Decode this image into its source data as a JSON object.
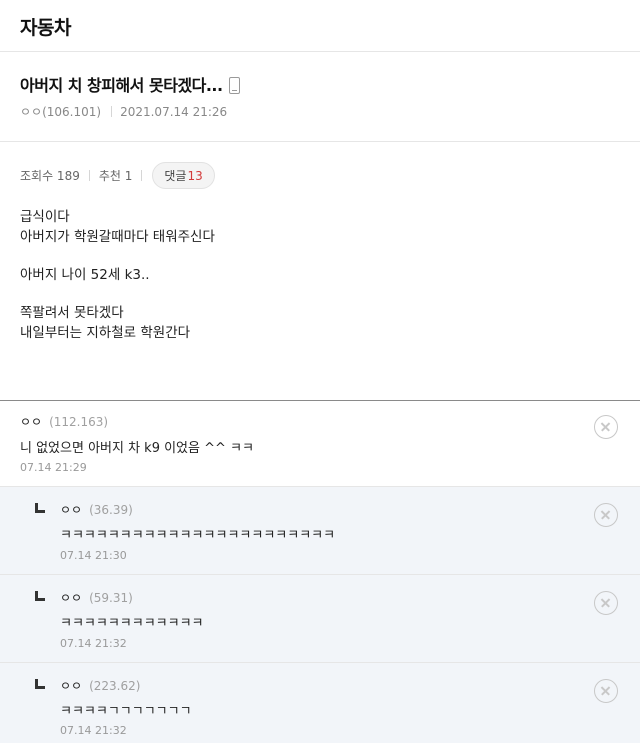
{
  "board": {
    "title": "자동차"
  },
  "post": {
    "title": "아버지 치 창피해서 못타겠다...",
    "author": "ㅇㅇ(106.101)",
    "datetime": "2021.07.14 21:26",
    "views_label": "조회수 189",
    "recommend_label": "추천 1",
    "comment_label": "댓글",
    "comment_count": "13",
    "body_lines": [
      "급식이다",
      "아버지가 학원갈때마다 태워주신다",
      "",
      "아버지 나이 52세 k3..",
      "",
      "쪽팔려서 못타겠다",
      "내일부터는 지하철로 학원간다"
    ]
  },
  "comments": [
    {
      "author": "ㅇㅇ",
      "ip": "(112.163)",
      "text": "니 없었으면 아버지 차 k9 이었음 ^^ ㅋㅋ",
      "date": "07.14 21:29"
    },
    {
      "author": "ㅇㅇ",
      "ip": "(36.39)",
      "text": "ㅋㅋㅋㅋㅋㅋㅋㅋㅋㅋㅋㅋㅋㅋㅋㅋㅋㅋㅋㅋㅋㅋㅋ",
      "date": "07.14 21:30"
    },
    {
      "author": "ㅇㅇ",
      "ip": "(59.31)",
      "text": "ㅋㅋㅋㅋㅋㅋㅋㅋㅋㅋㅋㅋ",
      "date": "07.14 21:32"
    },
    {
      "author": "ㅇㅇ",
      "ip": "(223.62)",
      "text": "ㅋㅋㅋㅋㄱㄱㄱㄱㄱㄱㄱ",
      "date": "07.14 21:32"
    }
  ],
  "icons": {
    "mobile": "mobile-phone-icon",
    "delete": "circle-x-icon",
    "reply": "reply-arrow-icon"
  },
  "colors": {
    "comment_count": "#d33b3b",
    "reply_background": "#f2f5f9"
  }
}
